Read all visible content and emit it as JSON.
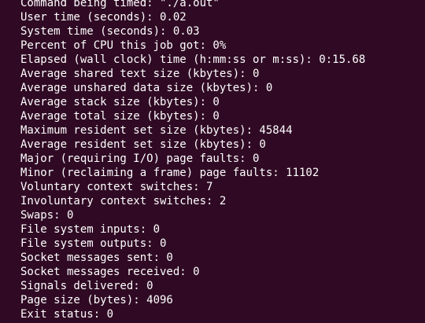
{
  "terminal": {
    "lines": [
      "Command being timed: \"./a.out\"",
      "User time (seconds): 0.02",
      "System time (seconds): 0.03",
      "Percent of CPU this job got: 0%",
      "Elapsed (wall clock) time (h:mm:ss or m:ss): 0:15.68",
      "Average shared text size (kbytes): 0",
      "Average unshared data size (kbytes): 0",
      "Average stack size (kbytes): 0",
      "Average total size (kbytes): 0",
      "Maximum resident set size (kbytes): 45844",
      "Average resident set size (kbytes): 0",
      "Major (requiring I/O) page faults: 0",
      "Minor (reclaiming a frame) page faults: 11102",
      "Voluntary context switches: 7",
      "Involuntary context switches: 2",
      "Swaps: 0",
      "File system inputs: 0",
      "File system outputs: 0",
      "Socket messages sent: 0",
      "Socket messages received: 0",
      "Signals delivered: 0",
      "Page size (bytes): 4096",
      "Exit status: 0"
    ]
  },
  "colors": {
    "background": "#300a24",
    "text": "#ffffff"
  }
}
